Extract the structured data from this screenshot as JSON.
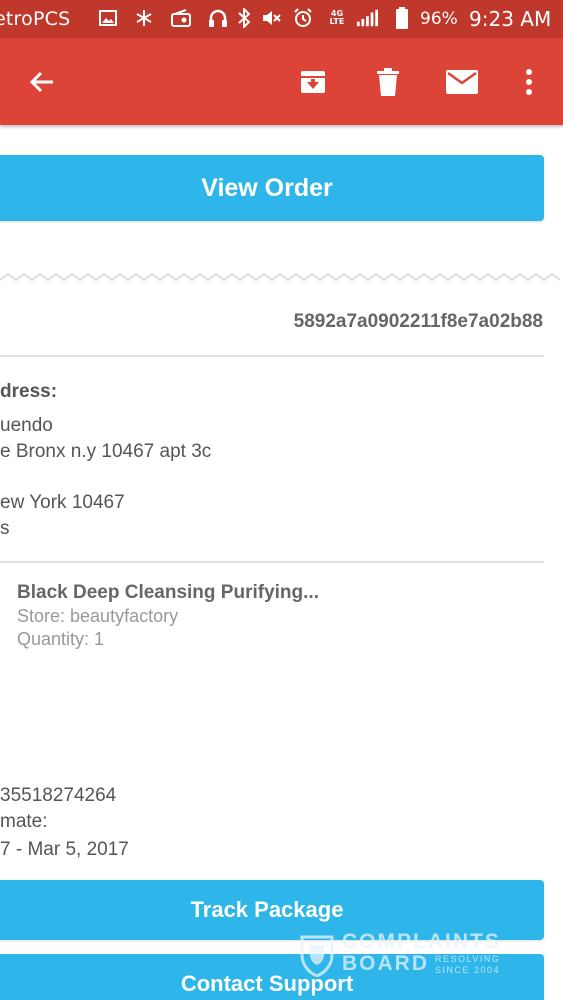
{
  "status_bar": {
    "carrier": "etroPCS",
    "battery_percent": "96%",
    "time": "9:23 AM",
    "network": "4G LTE",
    "icons": [
      "image-icon",
      "asterisk-icon",
      "radio-icon",
      "headset-icon",
      "bluetooth-icon",
      "vibrate-off-icon",
      "alarm-icon",
      "lte-icon",
      "signal-icon",
      "battery-icon"
    ]
  },
  "toolbar": {
    "back_icon": "arrow-back-icon",
    "actions": [
      "archive-icon",
      "delete-icon",
      "mark-unread-icon",
      "more-vert-icon"
    ]
  },
  "email": {
    "view_order_label": "View Order",
    "order_id": "5892a7a0902211f8e7a02b88",
    "address_heading": "dress:",
    "address_lines": [
      "uendo",
      "e Bronx n.y 10467 apt 3c",
      "ew York 10467",
      "s"
    ],
    "product": {
      "name": "Black Deep Cleansing Purifying...",
      "store": "Store: beautyfactory",
      "quantity": "Quantity: 1"
    },
    "tracking_number": "35518274264",
    "estimate_label": "mate:",
    "estimate_range": "7 - Mar 5, 2017",
    "track_package_label": "Track Package",
    "contact_support_label": "Contact Support"
  },
  "watermark": {
    "line1": "COMPLAINTS",
    "line2": "BOARD",
    "tagline1": "RESOLVING",
    "tagline2": "SINCE 2004"
  },
  "colors": {
    "status_bar": "#c0382b",
    "toolbar": "#db4437",
    "button": "#2eb5ea",
    "text_dark": "#555555",
    "text_light": "#999999"
  }
}
